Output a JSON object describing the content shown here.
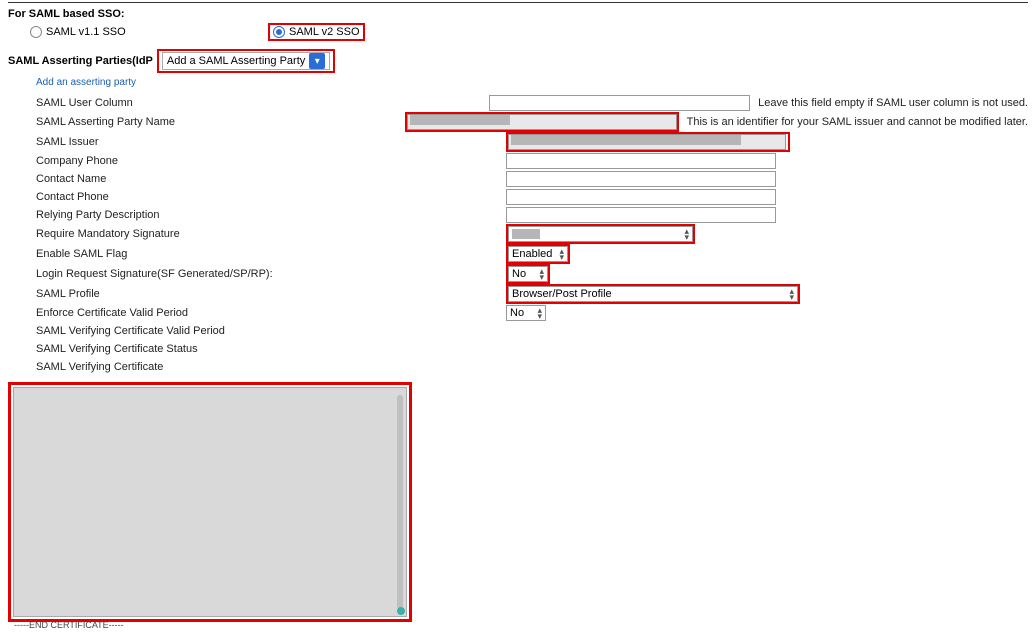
{
  "heading_sso": "For SAML based SSO:",
  "radio": {
    "v1_label": "SAML v1.1 SSO",
    "v2_label": "SAML v2 SSO"
  },
  "idp": {
    "label": "SAML Asserting Parties(IdP",
    "select_value": "Add a SAML Asserting Party",
    "add_link": "Add an asserting party"
  },
  "fields": {
    "user_column": {
      "label": "SAML User Column",
      "hint": "Leave this field empty if SAML user column is not used."
    },
    "asserting_party_name": {
      "label": "SAML Asserting Party Name",
      "hint": "This is an identifier for your SAML issuer and cannot be modified later."
    },
    "issuer": {
      "label": "SAML Issuer"
    },
    "company_phone": {
      "label": "Company Phone"
    },
    "contact_name": {
      "label": "Contact Name"
    },
    "contact_phone": {
      "label": "Contact Phone"
    },
    "relying_desc": {
      "label": "Relying Party Description"
    },
    "req_sig": {
      "label": "Require Mandatory Signature",
      "value": ""
    },
    "enable_flag": {
      "label": "Enable SAML Flag",
      "value": "Enabled"
    },
    "login_sig": {
      "label": "Login Request Signature(SF Generated/SP/RP):",
      "value": "No"
    },
    "profile": {
      "label": "SAML Profile",
      "value": "Browser/Post Profile"
    },
    "cert_valid": {
      "label": "Enforce Certificate Valid Period",
      "value": "No"
    },
    "ver_cert_valid": {
      "label": "SAML Verifying Certificate Valid Period"
    },
    "ver_cert_status": {
      "label": "SAML Verifying Certificate Status"
    },
    "ver_cert": {
      "label": "SAML Verifying Certificate"
    }
  },
  "certificate_end": "-----END CERTIFICATE-----"
}
